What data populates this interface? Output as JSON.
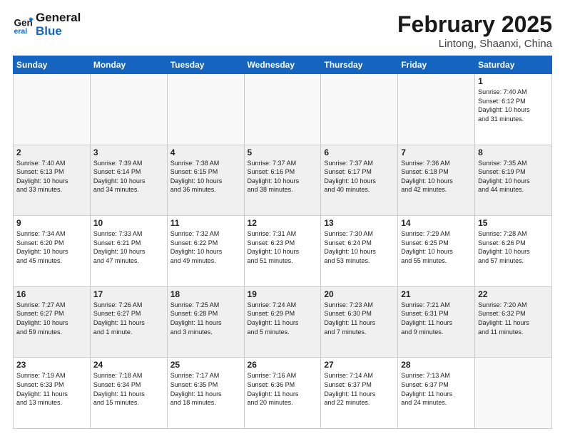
{
  "header": {
    "logo_line1": "General",
    "logo_line2": "Blue",
    "month": "February 2025",
    "location": "Lintong, Shaanxi, China"
  },
  "weekdays": [
    "Sunday",
    "Monday",
    "Tuesday",
    "Wednesday",
    "Thursday",
    "Friday",
    "Saturday"
  ],
  "weeks": [
    [
      {
        "day": "",
        "info": ""
      },
      {
        "day": "",
        "info": ""
      },
      {
        "day": "",
        "info": ""
      },
      {
        "day": "",
        "info": ""
      },
      {
        "day": "",
        "info": ""
      },
      {
        "day": "",
        "info": ""
      },
      {
        "day": "1",
        "info": "Sunrise: 7:40 AM\nSunset: 6:12 PM\nDaylight: 10 hours\nand 31 minutes."
      }
    ],
    [
      {
        "day": "2",
        "info": "Sunrise: 7:40 AM\nSunset: 6:13 PM\nDaylight: 10 hours\nand 33 minutes."
      },
      {
        "day": "3",
        "info": "Sunrise: 7:39 AM\nSunset: 6:14 PM\nDaylight: 10 hours\nand 34 minutes."
      },
      {
        "day": "4",
        "info": "Sunrise: 7:38 AM\nSunset: 6:15 PM\nDaylight: 10 hours\nand 36 minutes."
      },
      {
        "day": "5",
        "info": "Sunrise: 7:37 AM\nSunset: 6:16 PM\nDaylight: 10 hours\nand 38 minutes."
      },
      {
        "day": "6",
        "info": "Sunrise: 7:37 AM\nSunset: 6:17 PM\nDaylight: 10 hours\nand 40 minutes."
      },
      {
        "day": "7",
        "info": "Sunrise: 7:36 AM\nSunset: 6:18 PM\nDaylight: 10 hours\nand 42 minutes."
      },
      {
        "day": "8",
        "info": "Sunrise: 7:35 AM\nSunset: 6:19 PM\nDaylight: 10 hours\nand 44 minutes."
      }
    ],
    [
      {
        "day": "9",
        "info": "Sunrise: 7:34 AM\nSunset: 6:20 PM\nDaylight: 10 hours\nand 45 minutes."
      },
      {
        "day": "10",
        "info": "Sunrise: 7:33 AM\nSunset: 6:21 PM\nDaylight: 10 hours\nand 47 minutes."
      },
      {
        "day": "11",
        "info": "Sunrise: 7:32 AM\nSunset: 6:22 PM\nDaylight: 10 hours\nand 49 minutes."
      },
      {
        "day": "12",
        "info": "Sunrise: 7:31 AM\nSunset: 6:23 PM\nDaylight: 10 hours\nand 51 minutes."
      },
      {
        "day": "13",
        "info": "Sunrise: 7:30 AM\nSunset: 6:24 PM\nDaylight: 10 hours\nand 53 minutes."
      },
      {
        "day": "14",
        "info": "Sunrise: 7:29 AM\nSunset: 6:25 PM\nDaylight: 10 hours\nand 55 minutes."
      },
      {
        "day": "15",
        "info": "Sunrise: 7:28 AM\nSunset: 6:26 PM\nDaylight: 10 hours\nand 57 minutes."
      }
    ],
    [
      {
        "day": "16",
        "info": "Sunrise: 7:27 AM\nSunset: 6:27 PM\nDaylight: 10 hours\nand 59 minutes."
      },
      {
        "day": "17",
        "info": "Sunrise: 7:26 AM\nSunset: 6:27 PM\nDaylight: 11 hours\nand 1 minute."
      },
      {
        "day": "18",
        "info": "Sunrise: 7:25 AM\nSunset: 6:28 PM\nDaylight: 11 hours\nand 3 minutes."
      },
      {
        "day": "19",
        "info": "Sunrise: 7:24 AM\nSunset: 6:29 PM\nDaylight: 11 hours\nand 5 minutes."
      },
      {
        "day": "20",
        "info": "Sunrise: 7:23 AM\nSunset: 6:30 PM\nDaylight: 11 hours\nand 7 minutes."
      },
      {
        "day": "21",
        "info": "Sunrise: 7:21 AM\nSunset: 6:31 PM\nDaylight: 11 hours\nand 9 minutes."
      },
      {
        "day": "22",
        "info": "Sunrise: 7:20 AM\nSunset: 6:32 PM\nDaylight: 11 hours\nand 11 minutes."
      }
    ],
    [
      {
        "day": "23",
        "info": "Sunrise: 7:19 AM\nSunset: 6:33 PM\nDaylight: 11 hours\nand 13 minutes."
      },
      {
        "day": "24",
        "info": "Sunrise: 7:18 AM\nSunset: 6:34 PM\nDaylight: 11 hours\nand 15 minutes."
      },
      {
        "day": "25",
        "info": "Sunrise: 7:17 AM\nSunset: 6:35 PM\nDaylight: 11 hours\nand 18 minutes."
      },
      {
        "day": "26",
        "info": "Sunrise: 7:16 AM\nSunset: 6:36 PM\nDaylight: 11 hours\nand 20 minutes."
      },
      {
        "day": "27",
        "info": "Sunrise: 7:14 AM\nSunset: 6:37 PM\nDaylight: 11 hours\nand 22 minutes."
      },
      {
        "day": "28",
        "info": "Sunrise: 7:13 AM\nSunset: 6:37 PM\nDaylight: 11 hours\nand 24 minutes."
      },
      {
        "day": "",
        "info": ""
      }
    ]
  ]
}
